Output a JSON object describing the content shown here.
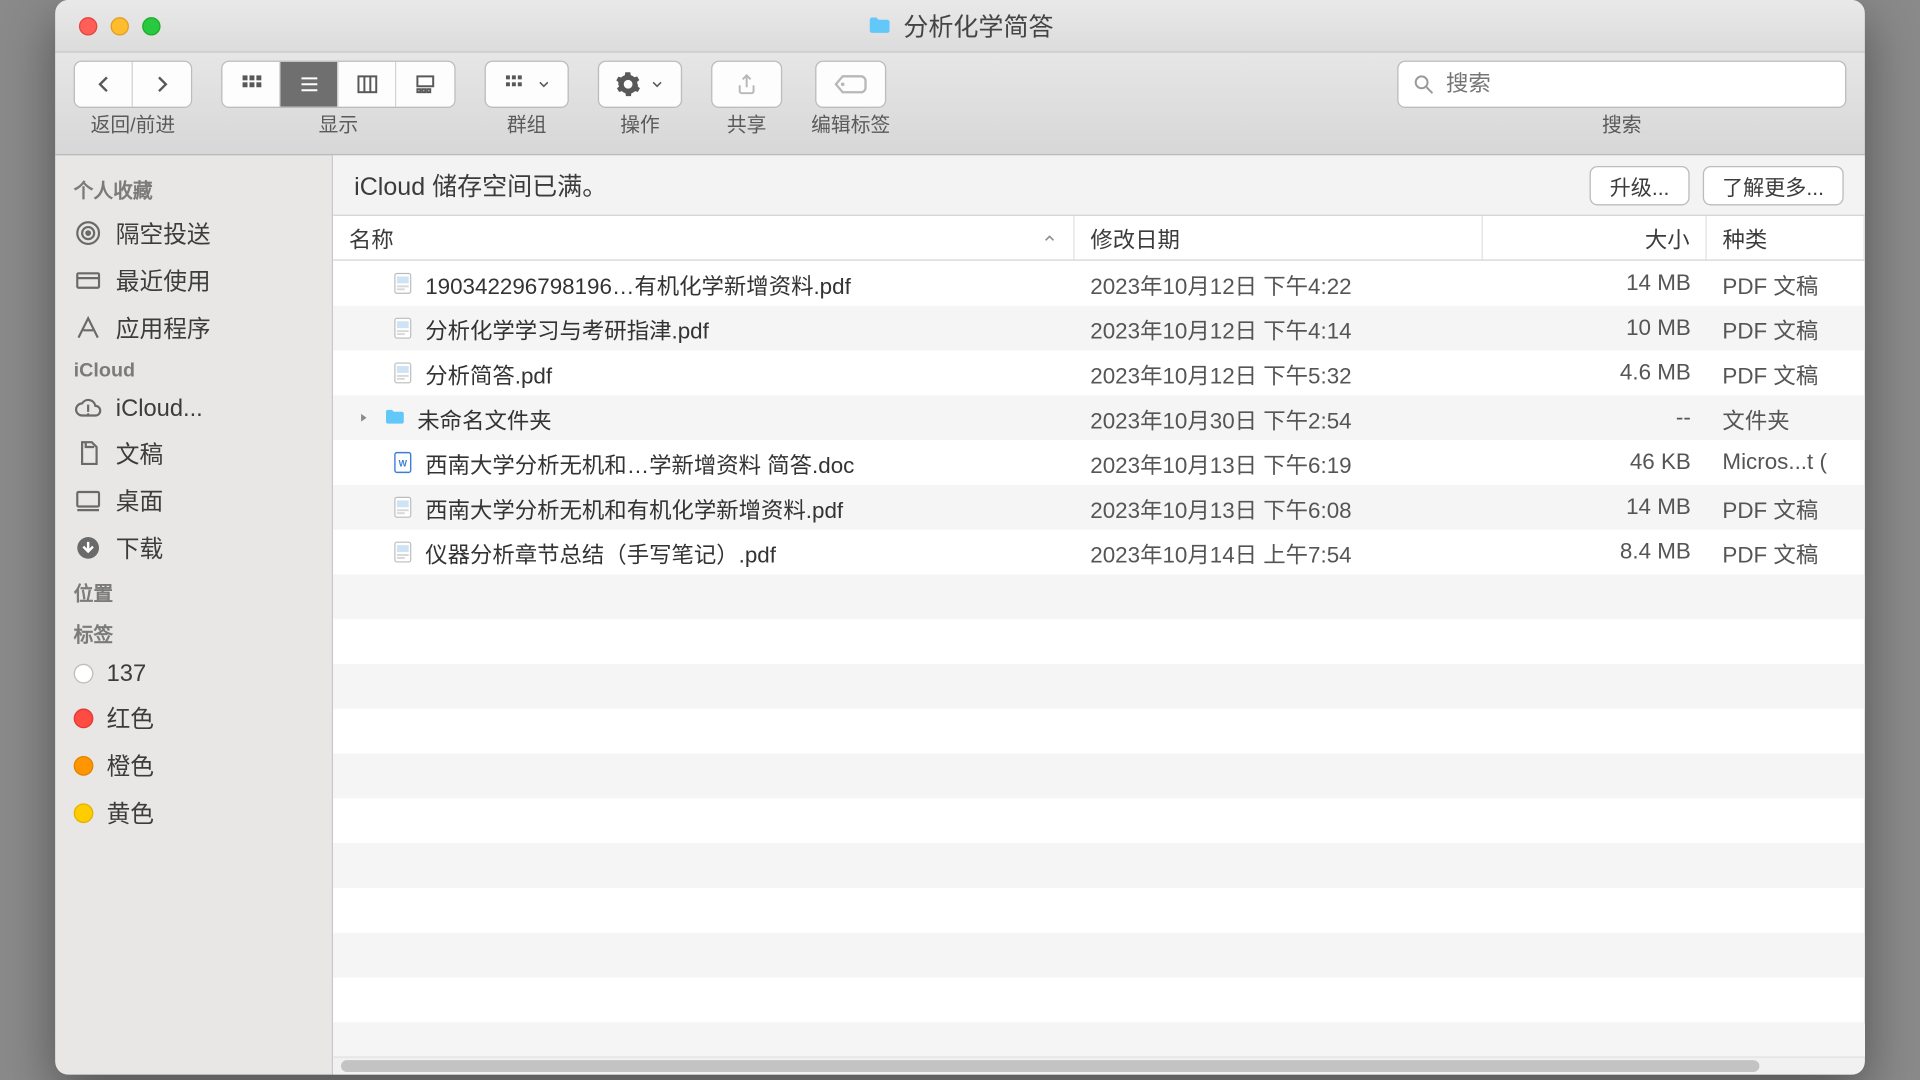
{
  "window": {
    "title": "分析化学简答"
  },
  "toolbar": {
    "back_forward_label": "返回/前进",
    "view_label": "显示",
    "group_label": "群组",
    "action_label": "操作",
    "share_label": "共享",
    "tags_label": "编辑标签",
    "search_label": "搜索",
    "search_placeholder": "搜索"
  },
  "banner": {
    "text": "iCloud 储存空间已满。",
    "upgrade": "升级...",
    "learn_more": "了解更多..."
  },
  "columns": {
    "name": "名称",
    "date": "修改日期",
    "size": "大小",
    "kind": "种类"
  },
  "sidebar": {
    "favorites_head": "个人收藏",
    "favorites": [
      {
        "label": "隔空投送"
      },
      {
        "label": "最近使用"
      },
      {
        "label": "应用程序"
      }
    ],
    "icloud_head": "iCloud",
    "icloud": [
      {
        "label": "iCloud..."
      },
      {
        "label": "文稿"
      },
      {
        "label": "桌面"
      },
      {
        "label": "下载"
      }
    ],
    "locations_head": "位置",
    "tags_head": "标签",
    "tags": [
      {
        "label": "137",
        "color": "#ffffff",
        "border": "#bdbdbd"
      },
      {
        "label": "红色",
        "color": "#ff4b42",
        "border": "#e03a32"
      },
      {
        "label": "橙色",
        "color": "#ff9500",
        "border": "#e08400"
      },
      {
        "label": "黄色",
        "color": "#ffcc00",
        "border": "#e0b400"
      }
    ]
  },
  "files": [
    {
      "type": "pdf",
      "name": "190342296798196…有机化学新增资料.pdf",
      "date": "2023年10月12日 下午4:22",
      "size": "14 MB",
      "kind": "PDF 文稿"
    },
    {
      "type": "pdf",
      "name": "分析化学学习与考研指津.pdf",
      "date": "2023年10月12日 下午4:14",
      "size": "10 MB",
      "kind": "PDF 文稿"
    },
    {
      "type": "pdf",
      "name": "分析简答.pdf",
      "date": "2023年10月12日 下午5:32",
      "size": "4.6 MB",
      "kind": "PDF 文稿"
    },
    {
      "type": "folder",
      "name": "未命名文件夹",
      "date": "2023年10月30日 下午2:54",
      "size": "--",
      "kind": "文件夹"
    },
    {
      "type": "doc",
      "name": "西南大学分析无机和…学新增资料 简答.doc",
      "date": "2023年10月13日 下午6:19",
      "size": "46 KB",
      "kind": "Micros...t ("
    },
    {
      "type": "pdf",
      "name": "西南大学分析无机和有机化学新增资料.pdf",
      "date": "2023年10月13日 下午6:08",
      "size": "14 MB",
      "kind": "PDF 文稿"
    },
    {
      "type": "pdf",
      "name": "仪器分析章节总结（手写笔记）.pdf",
      "date": "2023年10月14日 上午7:54",
      "size": "8.4 MB",
      "kind": "PDF 文稿"
    }
  ]
}
